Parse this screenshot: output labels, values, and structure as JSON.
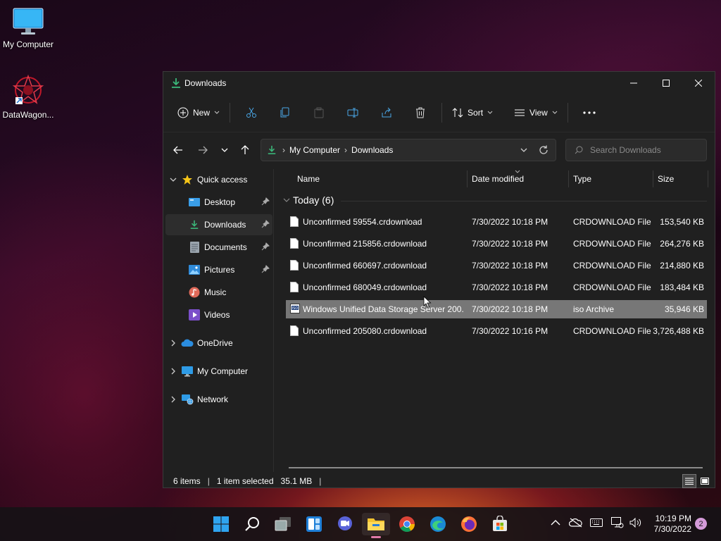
{
  "desktop": {
    "icons": [
      {
        "label": "My Computer"
      },
      {
        "label": "DataWagon..."
      }
    ]
  },
  "window": {
    "title": "Downloads",
    "controls": {
      "minimize": "minimize",
      "maximize": "maximize",
      "close": "close"
    }
  },
  "toolbar": {
    "new_label": "New",
    "sort_label": "Sort",
    "view_label": "View",
    "more_label": "..."
  },
  "address": {
    "crumbs": [
      "My Computer",
      "Downloads"
    ]
  },
  "search": {
    "placeholder": "Search Downloads"
  },
  "navpane": {
    "quick_access": "Quick access",
    "pinned": [
      {
        "label": "Desktop",
        "pinned": true
      },
      {
        "label": "Downloads",
        "pinned": true,
        "selected": true
      },
      {
        "label": "Documents",
        "pinned": true
      },
      {
        "label": "Pictures",
        "pinned": true
      },
      {
        "label": "Music",
        "pinned": false
      },
      {
        "label": "Videos",
        "pinned": false
      }
    ],
    "roots": [
      {
        "label": "OneDrive"
      },
      {
        "label": "My Computer"
      },
      {
        "label": "Network"
      }
    ]
  },
  "columns": {
    "name": "Name",
    "date": "Date modified",
    "type": "Type",
    "size": "Size"
  },
  "group": {
    "label": "Today (6)"
  },
  "files": [
    {
      "name": "Unconfirmed 59554.crdownload",
      "date": "7/30/2022 10:18 PM",
      "type": "CRDOWNLOAD File",
      "size": "153,540 KB",
      "icon": "file-icon"
    },
    {
      "name": "Unconfirmed 215856.crdownload",
      "date": "7/30/2022 10:18 PM",
      "type": "CRDOWNLOAD File",
      "size": "264,276 KB",
      "icon": "file-icon"
    },
    {
      "name": "Unconfirmed 660697.crdownload",
      "date": "7/30/2022 10:18 PM",
      "type": "CRDOWNLOAD File",
      "size": "214,880 KB",
      "icon": "file-icon"
    },
    {
      "name": "Unconfirmed 680049.crdownload",
      "date": "7/30/2022 10:18 PM",
      "type": "CRDOWNLOAD File",
      "size": "183,484 KB",
      "icon": "file-icon"
    },
    {
      "name": "Windows Unified Data Storage Server 200...",
      "date": "7/30/2022 10:18 PM",
      "type": "iso Archive",
      "size": "35,946 KB",
      "icon": "iso-icon",
      "selected": true
    },
    {
      "name": "Unconfirmed 205080.crdownload",
      "date": "7/30/2022 10:16 PM",
      "type": "CRDOWNLOAD File",
      "size": "3,726,488 KB",
      "icon": "file-icon"
    }
  ],
  "status": {
    "count": "6 items",
    "selection": "1 item selected",
    "selection_size": "35.1 MB"
  },
  "taskbar": {
    "apps": [
      "start-icon",
      "search-icon",
      "task-view-icon",
      "widgets-icon",
      "chat-icon",
      "file-explorer-icon",
      "chrome-icon",
      "edge-icon",
      "firefox-icon",
      "store-icon"
    ],
    "clock_time": "10:19 PM",
    "clock_date": "7/30/2022",
    "notification_count": "2"
  },
  "colors": {
    "window_bg": "#202020",
    "selection": "#777777",
    "accent_green": "#3bb87a"
  }
}
